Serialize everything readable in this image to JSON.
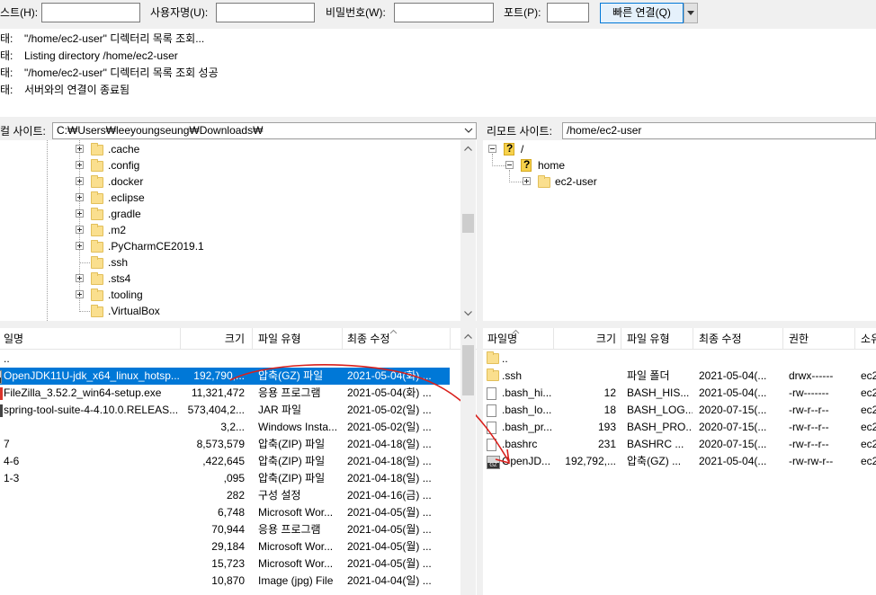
{
  "quickconnect": {
    "host_label": "스트(H):",
    "host_value": "",
    "user_label": "사용자명(U):",
    "user_value": "",
    "pass_label": "비밀번호(W):",
    "pass_value": "",
    "port_label": "포트(P):",
    "port_value": "",
    "connect_label": "빠른 연결(Q)",
    "dropdown_icon": "triangle-down-icon"
  },
  "message_log": [
    {
      "prefix": "태:",
      "text": "\"/home/ec2-user\" 디렉터리 목록 조회..."
    },
    {
      "prefix": "태:",
      "text": "Listing directory /home/ec2-user"
    },
    {
      "prefix": "태:",
      "text": "\"/home/ec2-user\" 디렉터리 목록 조회 성공"
    },
    {
      "prefix": "태:",
      "text": "서버와의 연결이 종료됨"
    }
  ],
  "local_site": {
    "label": "컬 사이트:",
    "path": "C:₩Users₩leeyoungseung₩Downloads₩"
  },
  "remote_site": {
    "label": "리모트 사이트:",
    "path": "/home/ec2-user"
  },
  "local_tree": [
    {
      "name": ".cache",
      "icon": "folder-icon",
      "expander": "expand-plus-icon"
    },
    {
      "name": ".config",
      "icon": "folder-icon",
      "expander": "expand-plus-icon"
    },
    {
      "name": ".docker",
      "icon": "folder-icon",
      "expander": "expand-plus-icon"
    },
    {
      "name": ".eclipse",
      "icon": "folder-icon",
      "expander": "expand-plus-icon"
    },
    {
      "name": ".gradle",
      "icon": "folder-icon",
      "expander": "expand-plus-icon"
    },
    {
      "name": ".m2",
      "icon": "folder-icon",
      "expander": "expand-plus-icon"
    },
    {
      "name": ".PyCharmCE2019.1",
      "icon": "folder-icon",
      "expander": "expand-plus-icon"
    },
    {
      "name": ".ssh",
      "icon": "folder-icon",
      "expander": null
    },
    {
      "name": ".sts4",
      "icon": "folder-icon",
      "expander": "expand-plus-icon"
    },
    {
      "name": ".tooling",
      "icon": "folder-icon",
      "expander": "expand-plus-icon"
    },
    {
      "name": ".VirtualBox",
      "icon": "folder-icon",
      "expander": null
    }
  ],
  "remote_tree": [
    {
      "name": "/",
      "icon": "unknown-folder-icon",
      "expander": "collapse-minus-icon",
      "level": 0
    },
    {
      "name": "home",
      "icon": "unknown-folder-icon",
      "expander": "collapse-minus-icon",
      "level": 1
    },
    {
      "name": "ec2-user",
      "icon": "folder-icon",
      "expander": "expand-plus-icon",
      "level": 2
    }
  ],
  "local_files": {
    "headers": {
      "name": "일명",
      "size": "크기",
      "type": "파일 유형",
      "modified": "최종 수정"
    },
    "rows": [
      {
        "name": "..",
        "size": "",
        "type": "",
        "modified": ""
      },
      {
        "name": "OpenJDK11U-jdk_x64_linux_hotsp...",
        "size": "192,790,...",
        "type": "압축(GZ) 파일",
        "modified": "2021-05-04(화) ...",
        "selected": true,
        "icon": "gz-icon"
      },
      {
        "name": "FileZilla_3.52.2_win64-setup.exe",
        "size": "11,321,472",
        "type": "응용 프로그램",
        "modified": "2021-05-04(화) ...",
        "icon": "exe-icon"
      },
      {
        "name": "spring-tool-suite-4-4.10.0.RELEAS...",
        "size": "573,404,2...",
        "type": "JAR 파일",
        "modified": "2021-05-02(일) ...",
        "icon": "jar-icon"
      },
      {
        "name": "",
        "size": "3,2...",
        "type": "Windows Insta...",
        "modified": "2021-05-02(일) ..."
      },
      {
        "name": "7",
        "size": "8,573,579",
        "type": "압축(ZIP) 파일",
        "modified": "2021-04-18(일) ..."
      },
      {
        "name": "4-6",
        "size": ",422,645",
        "type": "압축(ZIP) 파일",
        "modified": "2021-04-18(일) ..."
      },
      {
        "name": "1-3",
        "size": ",095",
        "type": "압축(ZIP) 파일",
        "modified": "2021-04-18(일) ..."
      },
      {
        "name": "",
        "size": "282",
        "type": "구성 설정",
        "modified": "2021-04-16(금) ..."
      },
      {
        "name": "",
        "size": "6,748",
        "type": "Microsoft Wor...",
        "modified": "2021-04-05(월) ..."
      },
      {
        "name": "",
        "size": "70,944",
        "type": "응용 프로그램",
        "modified": "2021-04-05(월) ..."
      },
      {
        "name": "",
        "size": "29,184",
        "type": "Microsoft Wor...",
        "modified": "2021-04-05(월) ..."
      },
      {
        "name": "",
        "size": "15,723",
        "type": "Microsoft Wor...",
        "modified": "2021-04-05(월) ..."
      },
      {
        "name": "",
        "size": "10,870",
        "type": "Image (jpg) File",
        "modified": "2021-04-04(일) ..."
      }
    ]
  },
  "remote_files": {
    "headers": {
      "name": "파일명",
      "size": "크기",
      "type": "파일 유형",
      "modified": "최종 수정",
      "perms": "권한",
      "owner": "소유"
    },
    "rows": [
      {
        "icon": "folder-icon",
        "name": "..",
        "size": "",
        "type": "",
        "modified": "",
        "perms": "",
        "owner": ""
      },
      {
        "icon": "folder-icon",
        "name": ".ssh",
        "size": "",
        "type": "파일 폴더",
        "modified": "2021-05-04(...",
        "perms": "drwx------",
        "owner": "ec2"
      },
      {
        "icon": "file-icon",
        "name": ".bash_hi...",
        "size": "12",
        "type": "BASH_HIS...",
        "modified": "2021-05-04(...",
        "perms": "-rw-------",
        "owner": "ec2"
      },
      {
        "icon": "file-icon",
        "name": ".bash_lo...",
        "size": "18",
        "type": "BASH_LOG...",
        "modified": "2020-07-15(...",
        "perms": "-rw-r--r--",
        "owner": "ec2"
      },
      {
        "icon": "file-icon",
        "name": ".bash_pr...",
        "size": "193",
        "type": "BASH_PRO...",
        "modified": "2020-07-15(...",
        "perms": "-rw-r--r--",
        "owner": "ec2"
      },
      {
        "icon": "file-icon",
        "name": ".bashrc",
        "size": "231",
        "type": "BASHRC ...",
        "modified": "2020-07-15(...",
        "perms": "-rw-r--r--",
        "owner": "ec2"
      },
      {
        "icon": "gz-icon",
        "name": "OpenJD...",
        "size": "192,792,...",
        "type": "압축(GZ) ...",
        "modified": "2021-05-04(...",
        "perms": "-rw-rw-r--",
        "owner": "ec2"
      }
    ]
  },
  "colors": {
    "selection": "#0078d7",
    "annotation_arrow": "#d9201c",
    "connect_button_border": "#0078d7"
  }
}
